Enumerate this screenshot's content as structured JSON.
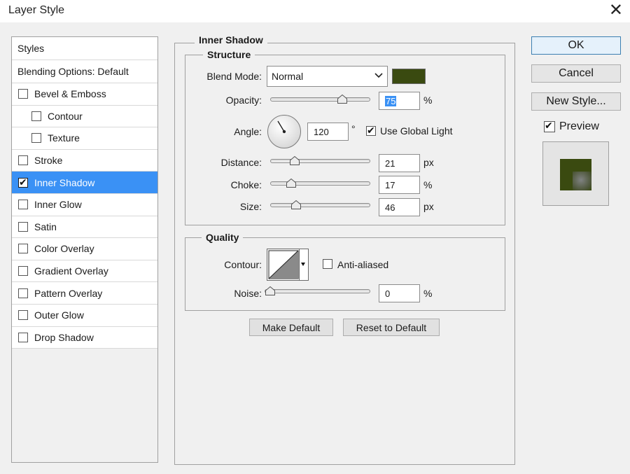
{
  "window": {
    "title": "Layer Style",
    "close_glyph": "✕"
  },
  "styles_list": {
    "header": "Styles",
    "blending": "Blending Options: Default",
    "items": [
      {
        "label": "Bevel & Emboss",
        "checked": false,
        "sub": false
      },
      {
        "label": "Contour",
        "checked": false,
        "sub": true
      },
      {
        "label": "Texture",
        "checked": false,
        "sub": true
      },
      {
        "label": "Stroke",
        "checked": false,
        "sub": false
      },
      {
        "label": "Inner Shadow",
        "checked": true,
        "sub": false,
        "selected": true
      },
      {
        "label": "Inner Glow",
        "checked": false,
        "sub": false
      },
      {
        "label": "Satin",
        "checked": false,
        "sub": false
      },
      {
        "label": "Color Overlay",
        "checked": false,
        "sub": false
      },
      {
        "label": "Gradient Overlay",
        "checked": false,
        "sub": false
      },
      {
        "label": "Pattern Overlay",
        "checked": false,
        "sub": false
      },
      {
        "label": "Outer Glow",
        "checked": false,
        "sub": false
      },
      {
        "label": "Drop Shadow",
        "checked": false,
        "sub": false
      }
    ]
  },
  "panel": {
    "title": "Inner Shadow",
    "structure": {
      "title": "Structure",
      "blend_mode_label": "Blend Mode:",
      "blend_mode_value": "Normal",
      "shadow_color": "#3a4a10",
      "opacity_label": "Opacity:",
      "opacity_value": "75",
      "opacity_unit": "%",
      "opacity_fraction": 0.75,
      "angle_label": "Angle:",
      "angle_value": "120",
      "angle_unit": "°",
      "global_light_label": "Use Global Light",
      "global_light_checked": true,
      "distance_label": "Distance:",
      "distance_value": "21",
      "distance_unit": "px",
      "distance_fraction": 0.21,
      "choke_label": "Choke:",
      "choke_value": "17",
      "choke_unit": "%",
      "choke_fraction": 0.17,
      "size_label": "Size:",
      "size_value": "46",
      "size_unit": "px",
      "size_fraction": 0.23
    },
    "quality": {
      "title": "Quality",
      "contour_label": "Contour:",
      "anti_aliased_label": "Anti-aliased",
      "anti_aliased_checked": false,
      "noise_label": "Noise:",
      "noise_value": "0",
      "noise_unit": "%",
      "noise_fraction": 0
    },
    "make_default_label": "Make Default",
    "reset_default_label": "Reset to Default"
  },
  "actions": {
    "ok_label": "OK",
    "cancel_label": "Cancel",
    "new_style_label": "New Style...",
    "preview_label": "Preview",
    "preview_checked": true,
    "preview_color": "#3a4a10"
  }
}
